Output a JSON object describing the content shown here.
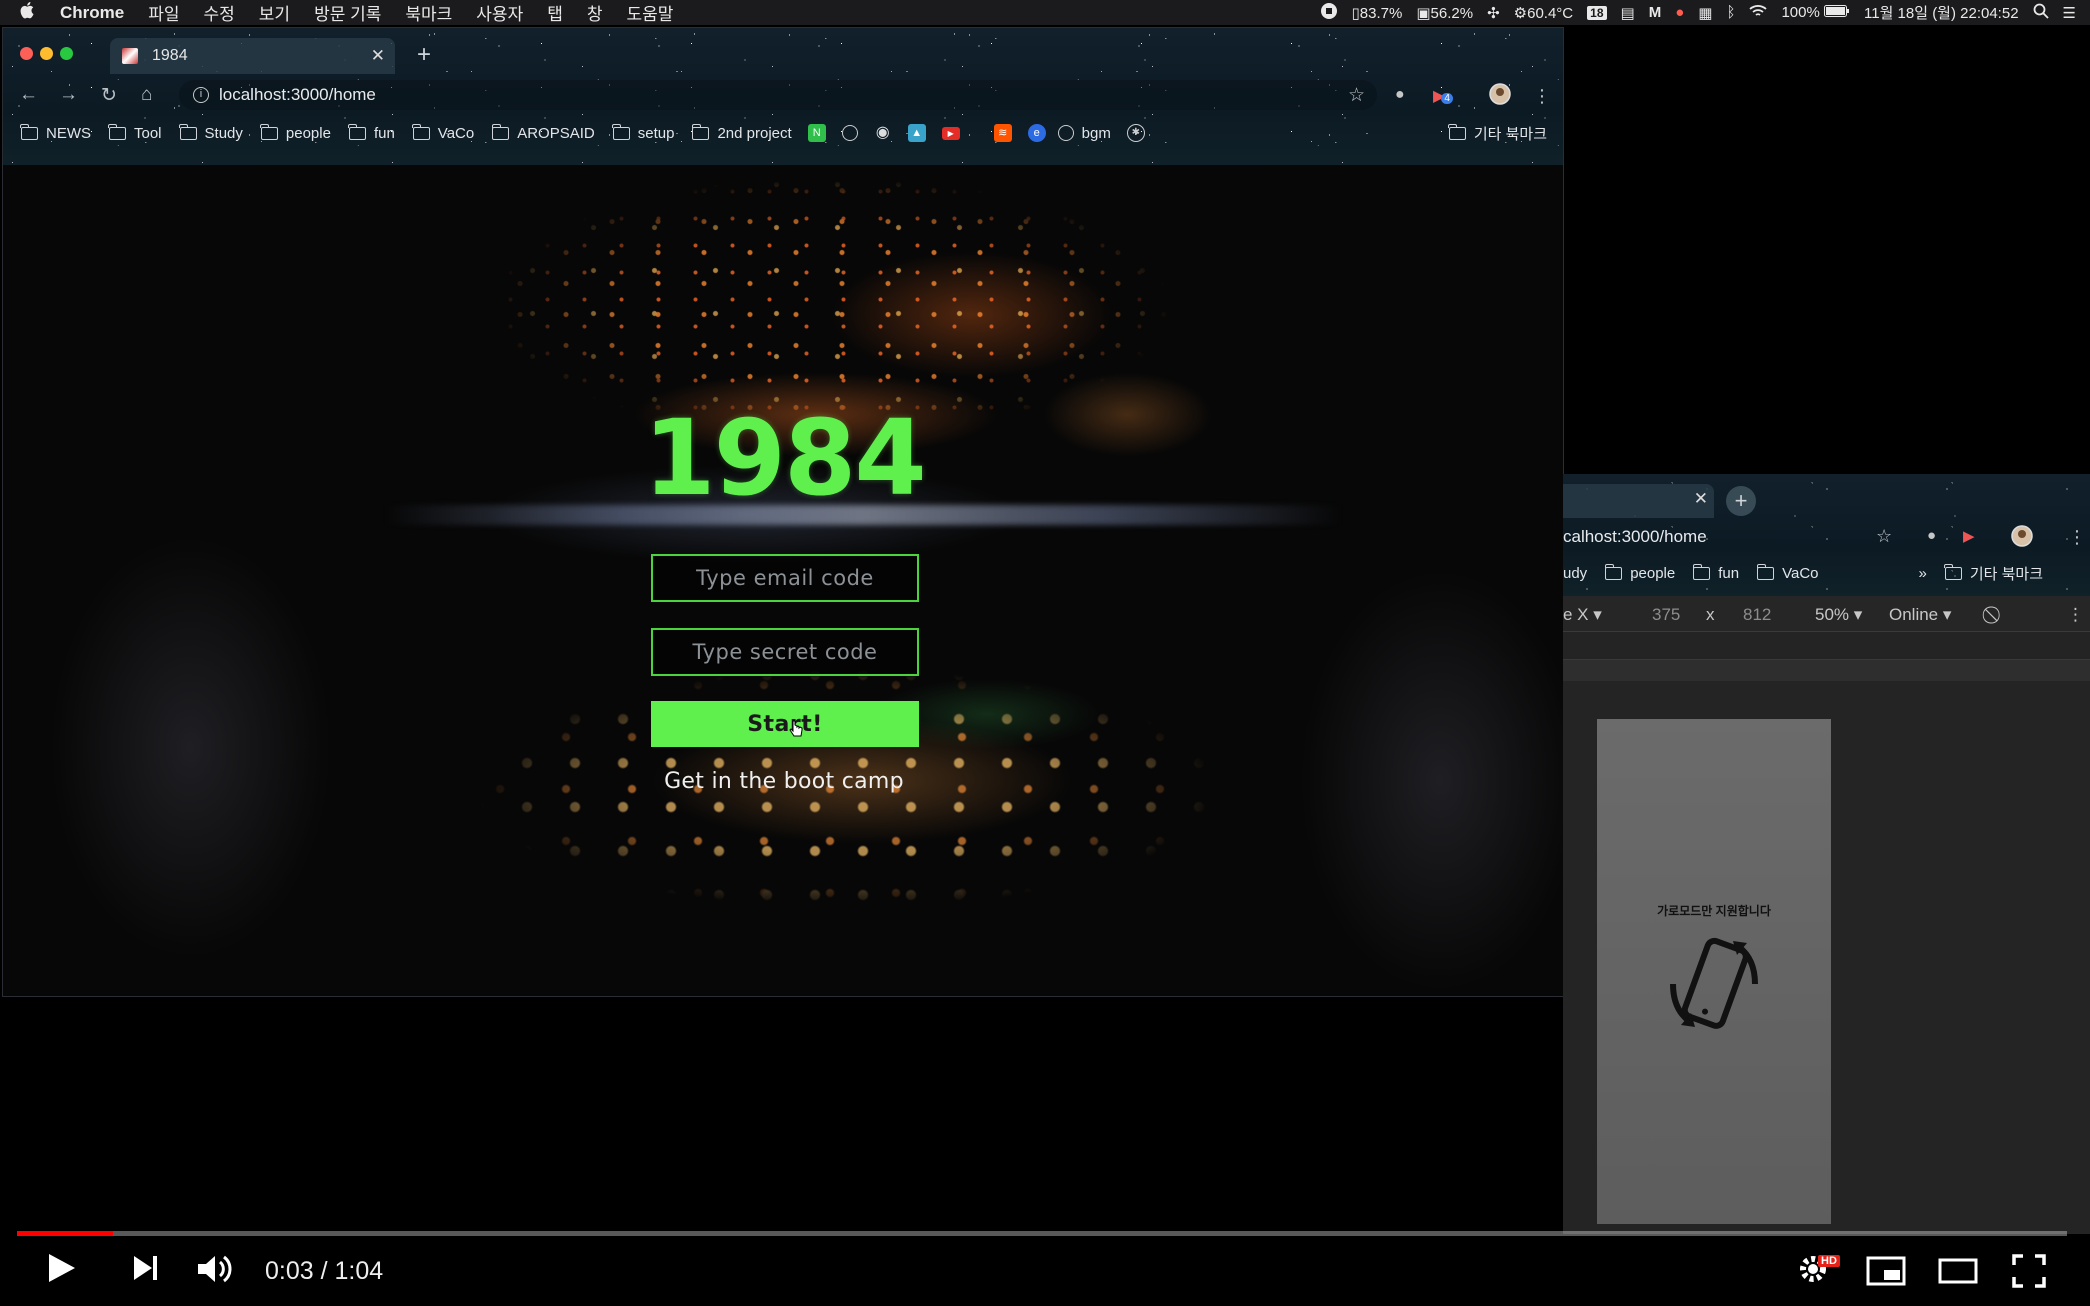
{
  "menubar": {
    "app_name": "Chrome",
    "items": [
      "파일",
      "수정",
      "보기",
      "방문 기록",
      "북마크",
      "사용자",
      "탭",
      "창",
      "도움말"
    ],
    "status": {
      "cpu": "83.7%",
      "memory": "56.2%",
      "temperature": "60.4°C",
      "calendar_badge": "18",
      "battery": "100%",
      "datetime": "11월 18일 (월)  22:04:52"
    }
  },
  "browser": {
    "tab_title": "1984",
    "url": "localhost:3000/home",
    "extension_badge": "4",
    "bookmarks": [
      "NEWS",
      "Tool",
      "Study",
      "people",
      "fun",
      "VaCo",
      "AROPSAID",
      "setup",
      "2nd project"
    ],
    "bookmark_bgm": "bgm",
    "other_bookmarks": "기타 북마크"
  },
  "page": {
    "title": "1984",
    "email_placeholder": "Type email code",
    "secret_placeholder": "Type secret code",
    "start_label": "Start!",
    "bootcamp_text": "Get in the boot camp",
    "accent_color": "#5ff04e"
  },
  "devtools": {
    "url_partial": "calhost:3000/home",
    "bookmarks_partial": [
      "udy",
      "people",
      "fun",
      "VaCo"
    ],
    "more_bookmarks": "»",
    "other_bookmarks": "기타 북마크",
    "device_select": "e X ▾",
    "width": "375",
    "times": "x",
    "height": "812",
    "zoom": "50% ▾",
    "throttle": "Online ▾",
    "device_message": "가로모드만 지원합니다"
  },
  "player": {
    "time": "0:03 / 1:04",
    "progress": 0.047,
    "hd_badge": "HD",
    "progress_color": "#ff0000"
  }
}
